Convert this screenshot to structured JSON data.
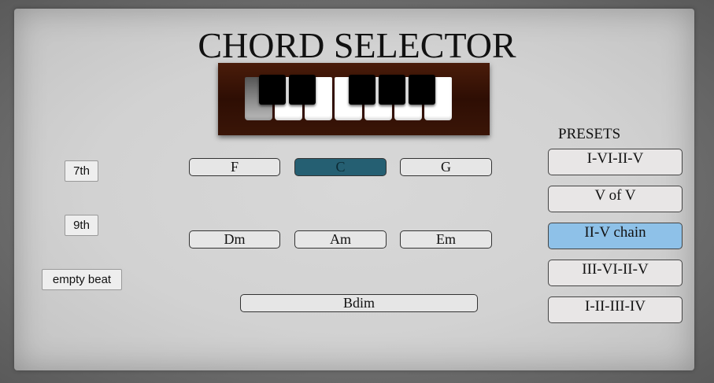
{
  "title": "CHORD SELECTOR",
  "modifiers": {
    "seventh": "7th",
    "ninth": "9th",
    "empty_beat": "empty beat"
  },
  "chords": {
    "row1": [
      "F",
      "C",
      "G"
    ],
    "row2": [
      "Dm",
      "Am",
      "Em"
    ],
    "row3": [
      "Bdim"
    ],
    "selected": "C"
  },
  "presets": {
    "label": "PRESETS",
    "items": [
      "I-VI-II-V",
      "V of V",
      "II-V chain",
      "III-VI-II-V",
      "I-II-III-IV"
    ],
    "selected": "II-V chain"
  },
  "colors": {
    "selected_chord": "#255f72",
    "selected_preset": "#8ec1e8",
    "piano_wood": "#3a1507"
  }
}
